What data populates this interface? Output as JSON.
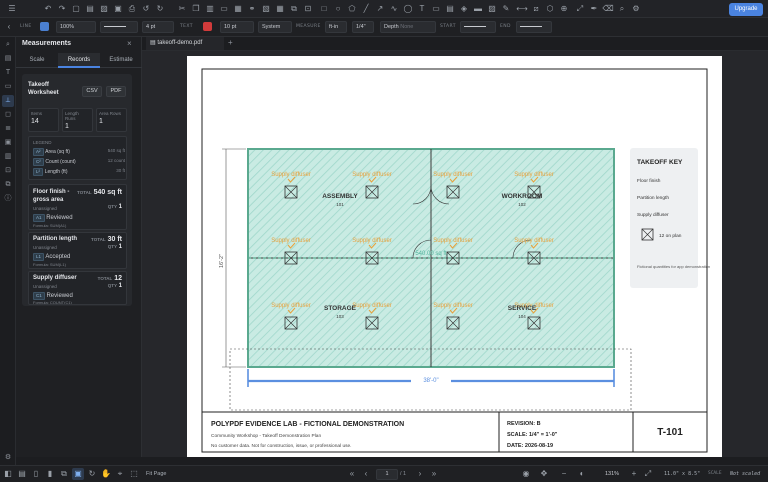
{
  "toolbar": {
    "upgrade_label": "Upgrade"
  },
  "props": {
    "line_label": "LINE",
    "line_color": "#4a7fd0",
    "opacity": "100%",
    "stroke_width": "4 pt",
    "text_label": "TEXT",
    "text_color": "#d23b3b",
    "font_size": "10 pt",
    "font": "System",
    "measure_label": "MEASURE",
    "measure_unit": "ft-in",
    "measure_scale": "1/4\"",
    "depth_label": "Depth",
    "depth_placeholder": "None",
    "start_label": "START",
    "end_label": "END"
  },
  "panel": {
    "title": "Measurements",
    "close": "×",
    "tabs": [
      "Scale",
      "Records",
      "Estimate"
    ],
    "worksheet_title": "Takeoff Worksheet",
    "csv": "CSV",
    "pdf": "PDF",
    "stats": [
      {
        "label": "Items",
        "value": "14"
      },
      {
        "label": "Length Runs",
        "value": "1"
      },
      {
        "label": "Area Rows",
        "value": "1"
      }
    ],
    "legend_title": "LEGEND",
    "legend": [
      {
        "chip": "A²",
        "name": "Area (sq ft)",
        "value": "540 sq ft"
      },
      {
        "chip": "C²",
        "name": "Count (count)",
        "value": "12 count"
      },
      {
        "chip": "L²",
        "name": "Length (ft)",
        "value": "30 ft"
      }
    ],
    "records": [
      {
        "name": "Floor finish - gross area",
        "total_label": "TOTAL",
        "total": "540 sq ft",
        "status": "Unassigned",
        "qty_label": "QTY",
        "qty": "1",
        "chip": "A1",
        "state": "Reviewed",
        "formula": "Formula: SUM(A1)"
      },
      {
        "name": "Partition length",
        "total_label": "TOTAL",
        "total": "30 ft",
        "status": "Unassigned",
        "qty_label": "QTY",
        "qty": "1",
        "chip": "L1",
        "state": "Accepted",
        "formula": "Formula: SUM(L1)"
      },
      {
        "name": "Supply diffuser",
        "total_label": "TOTAL",
        "total": "12",
        "status": "Unassigned",
        "qty_label": "QTY",
        "qty": "1",
        "chip": "C1",
        "state": "Reviewed",
        "formula": "Formula: COUNT(C1)"
      }
    ]
  },
  "doc_tab": {
    "name": "takeoff-demo.pdf",
    "add": "+"
  },
  "drawing": {
    "rooms": [
      {
        "name": "ASSEMBLY",
        "num": "101"
      },
      {
        "name": "WORKROOM",
        "num": "102"
      },
      {
        "name": "STORAGE",
        "num": "103"
      },
      {
        "name": "SERVICE",
        "num": "104"
      }
    ],
    "diffuser_label": "Supply diffuser",
    "area_label": "540.00 sq ft",
    "width_dim": "38'-0\"",
    "height_dim": "16'-2\"",
    "key": {
      "title": "TAKEOFF KEY",
      "items": [
        "Floor finish",
        "Partition length",
        "Supply diffuser"
      ],
      "symbol_label": "12 on plan",
      "note": "Fictional quantities for app demonstration"
    },
    "title_block": {
      "title": "POLYPDF EVIDENCE LAB - FICTIONAL DEMONSTRATION",
      "line1": "Community Workshop - Takeoff Demonstration Plan",
      "line2": "No customer data. Not for construction, issue, or professional use.",
      "revision": "REVISION: B",
      "scale": "SCALE: 1/4\" = 1'-0\"",
      "date": "DATE: 2026-08-19",
      "sheet": "T-101"
    }
  },
  "bottom": {
    "fit": "Fit Page",
    "page": "1",
    "page_total": "/ 1",
    "zoom": "131%",
    "size": "11.0\" x 8.5\"",
    "scale_label": "SCALE",
    "scale_state": "Not scaled"
  }
}
